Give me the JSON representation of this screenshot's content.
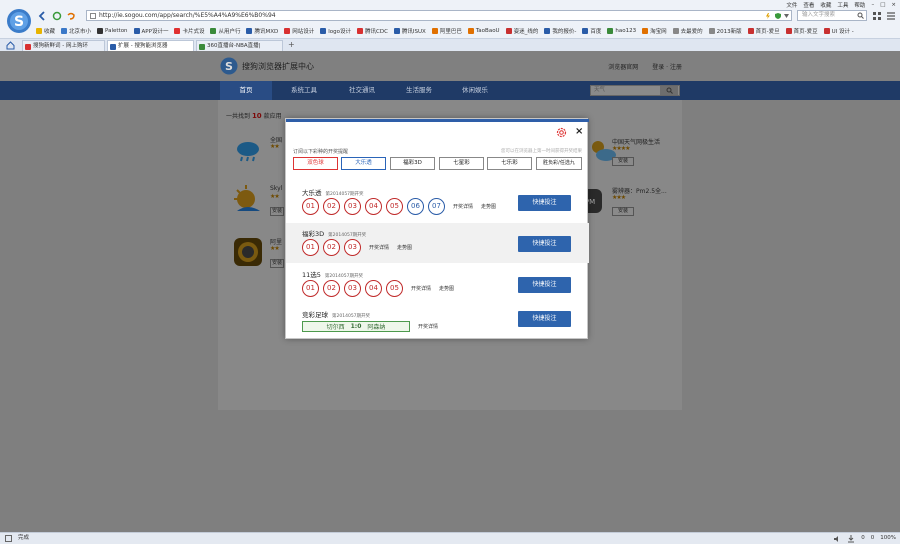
{
  "browser": {
    "window_menu": [
      "文件",
      "查看",
      "收藏",
      "工具",
      "帮助"
    ],
    "address_url": "http://ie.sogou.com/app/search/%E5%A4%A9%E6%B0%94",
    "search_placeholder": "输入文字搜索",
    "bookmarks": [
      {
        "label": "收藏",
        "color": "#e8b400"
      },
      {
        "label": "北京市小",
        "color": "#3a78c8"
      },
      {
        "label": "Paletton",
        "color": "#333333"
      },
      {
        "label": "APP设计一",
        "color": "#2a5ca8"
      },
      {
        "label": "卡片式设",
        "color": "#e03030"
      },
      {
        "label": "从用户行",
        "color": "#3a8a3a"
      },
      {
        "label": "腾讯MXD",
        "color": "#2a5ca8"
      },
      {
        "label": "网站设计",
        "color": "#d83030"
      },
      {
        "label": "logo设计",
        "color": "#2a5ca8"
      },
      {
        "label": "腾讯CDC",
        "color": "#d83030"
      },
      {
        "label": "腾讯ISUX",
        "color": "#2a5ca8"
      },
      {
        "label": "阿里巴巴",
        "color": "#e07000"
      },
      {
        "label": "TaoBaoU",
        "color": "#e07000"
      },
      {
        "label": "姿迷_线的",
        "color": "#c83030"
      },
      {
        "label": "我的报价-",
        "color": "#2a5ca8"
      },
      {
        "label": "百度",
        "color": "#2a5ca8"
      },
      {
        "label": "hao123",
        "color": "#3a8a3a"
      },
      {
        "label": "淘宝网",
        "color": "#e07000"
      },
      {
        "label": "去最爱的",
        "color": "#888888"
      },
      {
        "label": "2013新版",
        "color": "#888888"
      },
      {
        "label": "首页-爱旦",
        "color": "#c83030"
      },
      {
        "label": "首页-爱豆",
        "color": "#c83030"
      },
      {
        "label": "UI 设计 -",
        "color": "#c83030"
      }
    ],
    "tabs": [
      {
        "label": "搜狗新鲜词 - 网上购环",
        "color": "#d83030"
      },
      {
        "label": "扩展 - 搜狗能浏览器",
        "color": "#2a5ca8"
      },
      {
        "label": "360直播台-NBA直播|",
        "color": "#3a8a3a"
      }
    ],
    "status_left": "完成",
    "status_right": [
      "0",
      "0",
      "100%"
    ]
  },
  "site": {
    "title": "搜狗浏览器扩展中心",
    "header_links": [
      "浏览器官网",
      "登录 · 注册"
    ],
    "nav": [
      "首页",
      "系统工具",
      "社交通讯",
      "生活服务",
      "休闲娱乐"
    ],
    "search_placeholder": "天气",
    "result_prefix": "一共找到",
    "result_count": "10",
    "result_suffix": "款应用",
    "apps": [
      {
        "name": "全国",
        "stars": "★★",
        "install": "安装"
      },
      {
        "name": "Skyl",
        "stars": "★★",
        "install": "安装"
      },
      {
        "name": "阿里",
        "stars": "★★",
        "install": "安装"
      },
      {
        "name": "中国天气网极生活",
        "stars": "★★★★",
        "install": "安装"
      },
      {
        "name": "雾辨器：Pm2.5全...",
        "stars": "★★★",
        "install": "安装"
      }
    ]
  },
  "modal": {
    "hint": "订阅以下彩种的开奖提醒",
    "hint_right": "您可以在浏览器上第一时间获得开奖结果",
    "lottery_tabs": [
      "双色球",
      "大乐透",
      "福彩3D",
      "七星彩",
      "七乐彩",
      "胜负彩/任选九"
    ],
    "sections": [
      {
        "title": "大乐透",
        "issue": "第2014057期开奖",
        "balls_red": [
          "01",
          "02",
          "03",
          "04",
          "05"
        ],
        "balls_blue": [
          "06",
          "07"
        ],
        "links": [
          "开奖详情",
          "走势图"
        ],
        "button": "快捷投注"
      },
      {
        "title": "福彩3D",
        "issue": "第2014057期开奖",
        "balls_red": [
          "01",
          "02",
          "03"
        ],
        "balls_blue": [],
        "links": [
          "开奖详情",
          "走势图"
        ],
        "button": "快捷投注"
      },
      {
        "title": "11选5",
        "issue": "第2014057期开奖",
        "balls_red": [
          "01",
          "02",
          "03",
          "04",
          "05"
        ],
        "balls_blue": [],
        "links": [
          "开奖详情",
          "走势图"
        ],
        "button": "快捷投注"
      },
      {
        "title": "竞彩足球",
        "issue": "第2014057期开奖",
        "match_home": "切尔西",
        "match_score": "1:0",
        "match_away": "阿森纳",
        "links": [
          "开奖详情"
        ],
        "button": "快捷投注"
      }
    ]
  }
}
